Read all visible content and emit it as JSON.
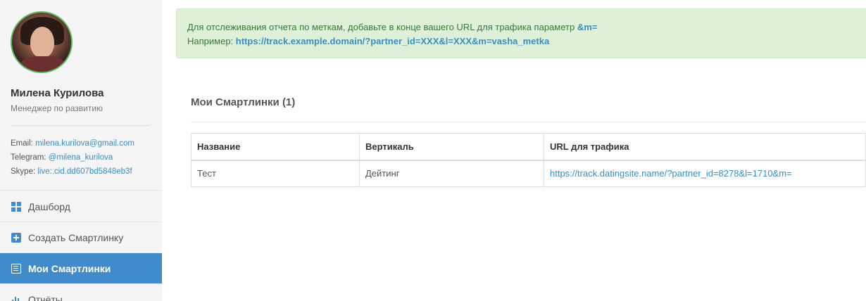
{
  "profile": {
    "name": "Милена Курилова",
    "role": "Менеджер по развитию",
    "email_label": "Email:",
    "email_value": "milena.kurilova@gmail.com",
    "telegram_label": "Telegram:",
    "telegram_value": "@milena_kurilova",
    "skype_label": "Skype:",
    "skype_value": "live:.cid.dd607bd5848eb3f"
  },
  "nav": {
    "items": [
      {
        "label": "Дашборд",
        "icon": "dashboard-grid-icon",
        "active": false
      },
      {
        "label": "Создать Смартлинку",
        "icon": "plus-square-icon",
        "active": false
      },
      {
        "label": "Мои Смартлинки",
        "icon": "list-icon",
        "active": true
      },
      {
        "label": "Отчёты",
        "icon": "bar-chart-icon",
        "active": false
      }
    ]
  },
  "alert": {
    "line1_text": "Для отслеживания отчета по меткам, добавьте в конце вашего URL для трафика параметр ",
    "line1_param": "&m=",
    "line2_text": "Например: ",
    "line2_example": "https://track.example.domain/?partner_id=XXX&l=XXX&m=vasha_metka"
  },
  "section": {
    "title": "Мои Смартлинки (1)"
  },
  "table": {
    "headers": [
      "Название",
      "Вертикаль",
      "URL для трафика"
    ],
    "rows": [
      {
        "name": "Тест",
        "vertical": "Дейтинг",
        "url": "https://track.datingsite.name/?partner_id=8278&l=1710&m="
      }
    ]
  },
  "colors": {
    "accent": "#428bca",
    "link": "#3c8dbc",
    "alert_bg": "#dff0d8",
    "alert_text": "#3c763d",
    "avatar_border": "#5cb85c"
  }
}
